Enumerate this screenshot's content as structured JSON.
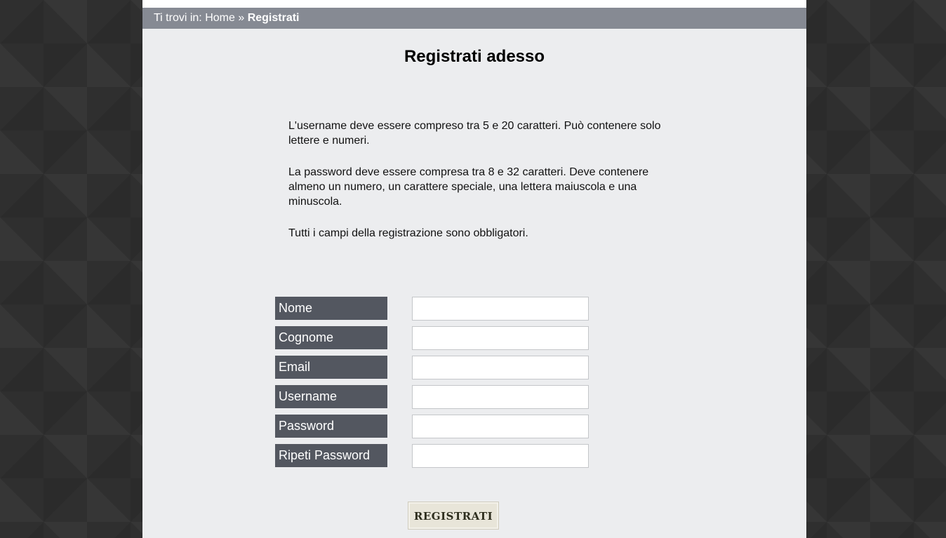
{
  "breadcrumb": {
    "prefix": "Ti trovi in:",
    "home": "Home",
    "separator": "»",
    "current": "Registrati"
  },
  "page": {
    "title": "Registrati adesso"
  },
  "rules": {
    "username": "L'username deve essere compreso tra 5 e 20 caratteri. Può contenere solo lettere e numeri.",
    "password": "La password deve essere compresa tra 8 e 32 caratteri. Deve contenere almeno un numero, un carattere speciale, una lettera maiuscola e una minuscola.",
    "required": "Tutti i campi della registrazione sono obbligatori."
  },
  "form": {
    "fields": [
      {
        "label": "Nome",
        "value": ""
      },
      {
        "label": "Cognome",
        "value": ""
      },
      {
        "label": "Email",
        "value": ""
      },
      {
        "label": "Username",
        "value": ""
      },
      {
        "label": "Password",
        "value": ""
      },
      {
        "label": "Ripeti Password",
        "value": ""
      }
    ],
    "submit_label": "REGISTRATI"
  },
  "colors": {
    "breadcrumb_bar": "#868a93",
    "content_background": "#ecedef",
    "label_background": "#535760",
    "button_background": "#e8e5d9"
  }
}
